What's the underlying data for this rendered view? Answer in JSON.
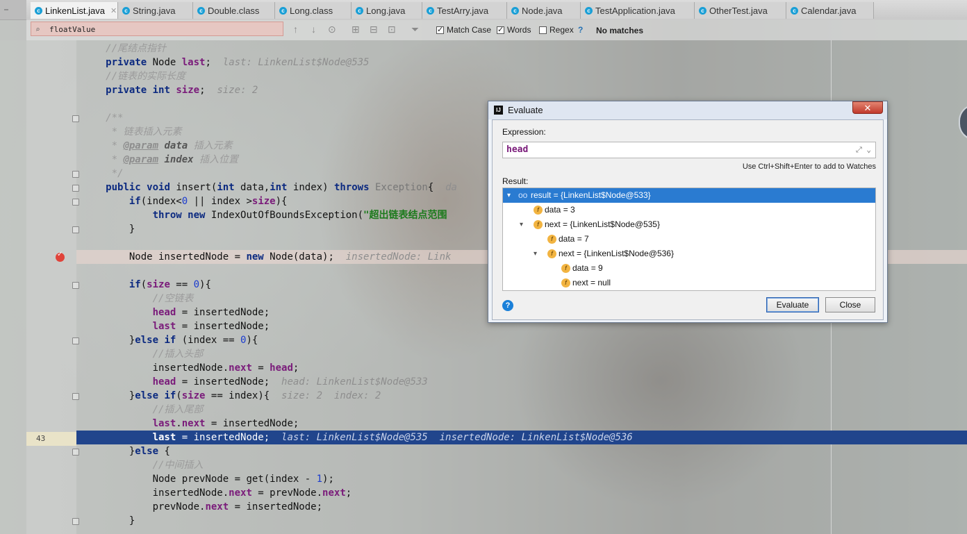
{
  "tabs": [
    {
      "label": "LinkenList.java",
      "active": true
    },
    {
      "label": "String.java"
    },
    {
      "label": "Double.class"
    },
    {
      "label": "Long.class"
    },
    {
      "label": "Long.java"
    },
    {
      "label": "TestArry.java"
    },
    {
      "label": "Node.java"
    },
    {
      "label": "TestApplication.java"
    },
    {
      "label": "OtherTest.java"
    },
    {
      "label": "Calendar.java"
    }
  ],
  "search": {
    "value": "floatValue",
    "match_case_label": "Match Case",
    "words_label": "Words",
    "regex_label": "Regex",
    "help": "?",
    "status": "No matches"
  },
  "gutter": {
    "current_line_number": "43"
  },
  "code": {
    "l1_comment": "//尾结点指针",
    "l2_kw": "private",
    "l2_type": " Node ",
    "l2_field": "last",
    "l2_semi": ";",
    "l2_hint": "  last: LinkenList$Node@535",
    "l3_comment": "//链表的实际长度",
    "l4_kw1": "private",
    "l4_kw2": "int",
    "l4_field": "size",
    "l4_semi": ";",
    "l4_hint": "  size: 2",
    "l5_doc": "/**",
    "l6_doc": " * 链表插入元素",
    "l7_pre": " * ",
    "l7_tag": "@param",
    "l7_name": " data",
    "l7_desc": " 插入元素",
    "l8_pre": " * ",
    "l8_tag": "@param",
    "l8_name": " index",
    "l8_desc": " 插入位置",
    "l9_doc": " */",
    "l10_kw1": "public",
    "l10_kw2": "void",
    "l10_a": " insert(",
    "l10_kw3": "int",
    "l10_b": " data,",
    "l10_kw4": "int",
    "l10_c": " index) ",
    "l10_kw5": "throws",
    "l10_exc": " Exception",
    "l10_d": "{  ",
    "l10_hint": "da",
    "l11_kw": "if",
    "l11_a": "(index<",
    "l11_n": "0",
    "l11_b": " || index >",
    "l11_f": "size",
    "l11_c": "){",
    "l12_kw1": "throw",
    "l12_kw2": "new",
    "l12_a": " IndexOutOfBoundsException(",
    "l12_str": "\"超出链表结点范围",
    "l13": "}",
    "l14_a": "Node insertedNode = ",
    "l14_kw": "new",
    "l14_b": " Node(data);",
    "l14_hint": "  insertedNode: Link",
    "l15_kw": "if",
    "l15_a": "(",
    "l15_f": "size",
    "l15_b": " == ",
    "l15_n": "0",
    "l15_c": "){",
    "l16_comment": "//空链表",
    "l17_f": "head",
    "l17_a": " = insertedNode;",
    "l18_f": "last",
    "l18_a": " = insertedNode;",
    "l19_a": "}",
    "l19_kw1": "else",
    "l19_kw2": "if",
    "l19_b": " (index == ",
    "l19_n": "0",
    "l19_c": "){",
    "l20_comment": "//插入头部",
    "l21_a": "insertedNode.",
    "l21_f1": "next",
    "l21_b": " = ",
    "l21_f2": "head",
    "l21_c": ";",
    "l22_f": "head",
    "l22_a": " = insertedNode;",
    "l22_hint": "  head: LinkenList$Node@533",
    "l23_a": "}",
    "l23_kw1": "else",
    "l23_kw2": "if",
    "l23_b": "(",
    "l23_f": "size",
    "l23_c": " == index){",
    "l23_hint": "  size: 2  index: 2",
    "l24_comment": "//插入尾部",
    "l25_f1": "last",
    "l25_a": ".",
    "l25_f2": "next",
    "l25_b": " = insertedNode;",
    "l26_f": "last",
    "l26_a": " = insertedNode;",
    "l26_hint": "  last: LinkenList$Node@535  insertedNode: LinkenList$Node@536",
    "l27_a": "}",
    "l27_kw": "else",
    "l27_b": " {",
    "l28_comment": "//中间插入",
    "l29_a": "Node prevNode = get(index - ",
    "l29_n": "1",
    "l29_b": ");",
    "l30_a": "insertedNode.",
    "l30_f1": "next",
    "l30_b": " = prevNode.",
    "l30_f2": "next",
    "l30_c": ";",
    "l31_a": "prevNode.",
    "l31_f": "next",
    "l31_b": " = insertedNode;",
    "l32": "}"
  },
  "dialog": {
    "title": "Evaluate",
    "close_glyph": "✕",
    "expression_label": "Expression:",
    "expression": "head",
    "watch_hint": "Use Ctrl+Shift+Enter to add to Watches",
    "result_label": "Result:",
    "result_rows": [
      {
        "text": "result = {LinkenList$Node@533}"
      },
      {
        "text": "data = 3"
      },
      {
        "text": "next = {LinkenList$Node@535}"
      },
      {
        "text": "data = 7"
      },
      {
        "text": "next = {LinkenList$Node@536}"
      },
      {
        "text": "data = 9"
      },
      {
        "text": "next = null"
      }
    ],
    "evaluate_label": "Evaluate",
    "close_label": "Close"
  }
}
